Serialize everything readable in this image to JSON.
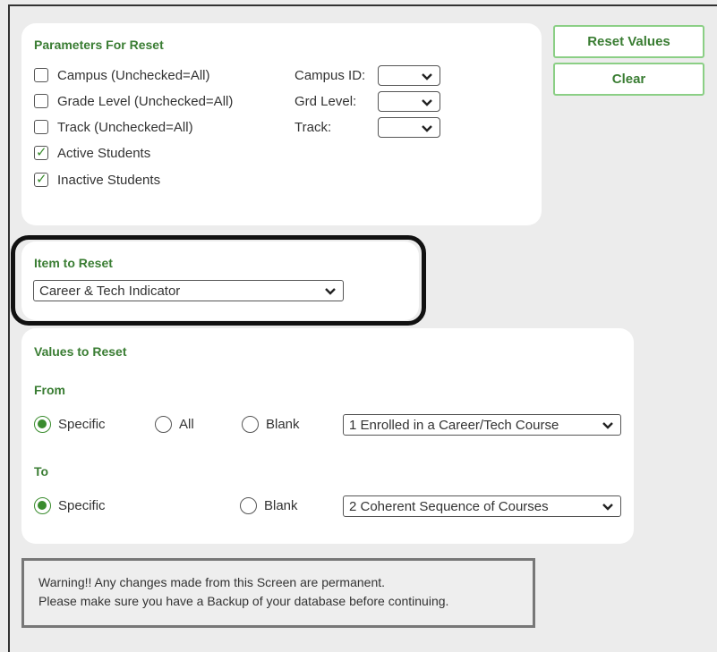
{
  "buttons": {
    "reset_values": "Reset Values",
    "clear": "Clear"
  },
  "parameters": {
    "title": "Parameters For Reset",
    "checkboxes": [
      {
        "label": "Campus (Unchecked=All)",
        "checked": false
      },
      {
        "label": "Grade Level (Unchecked=All)",
        "checked": false
      },
      {
        "label": "Track (Unchecked=All)",
        "checked": false
      },
      {
        "label": "Active Students",
        "checked": true
      },
      {
        "label": "Inactive Students",
        "checked": true
      }
    ],
    "campus_id_label": "Campus ID:",
    "grd_level_label": "Grd Level:",
    "track_label": "Track:"
  },
  "item_to_reset": {
    "title": "Item to Reset",
    "selected": "Career & Tech Indicator"
  },
  "values_to_reset": {
    "title": "Values to Reset",
    "from": {
      "label": "From",
      "options": [
        "Specific",
        "All",
        "Blank"
      ],
      "selected_option": "Specific",
      "select_value": "1 Enrolled in a Career/Tech Course"
    },
    "to": {
      "label": "To",
      "options": [
        "Specific",
        "Blank"
      ],
      "selected_option": "Specific",
      "select_value": "2 Coherent Sequence of Courses"
    }
  },
  "warning": {
    "line1": "Warning!! Any changes made from this Screen are permanent.",
    "line2": "Please make sure you have a Backup of your database before continuing."
  },
  "icons": {
    "dropdown": "chevron-down-icon",
    "checkmark": "checkmark-icon"
  },
  "colors": {
    "accent": "#3a7d33",
    "button_border": "#8bcf85",
    "background": "#ececec"
  }
}
